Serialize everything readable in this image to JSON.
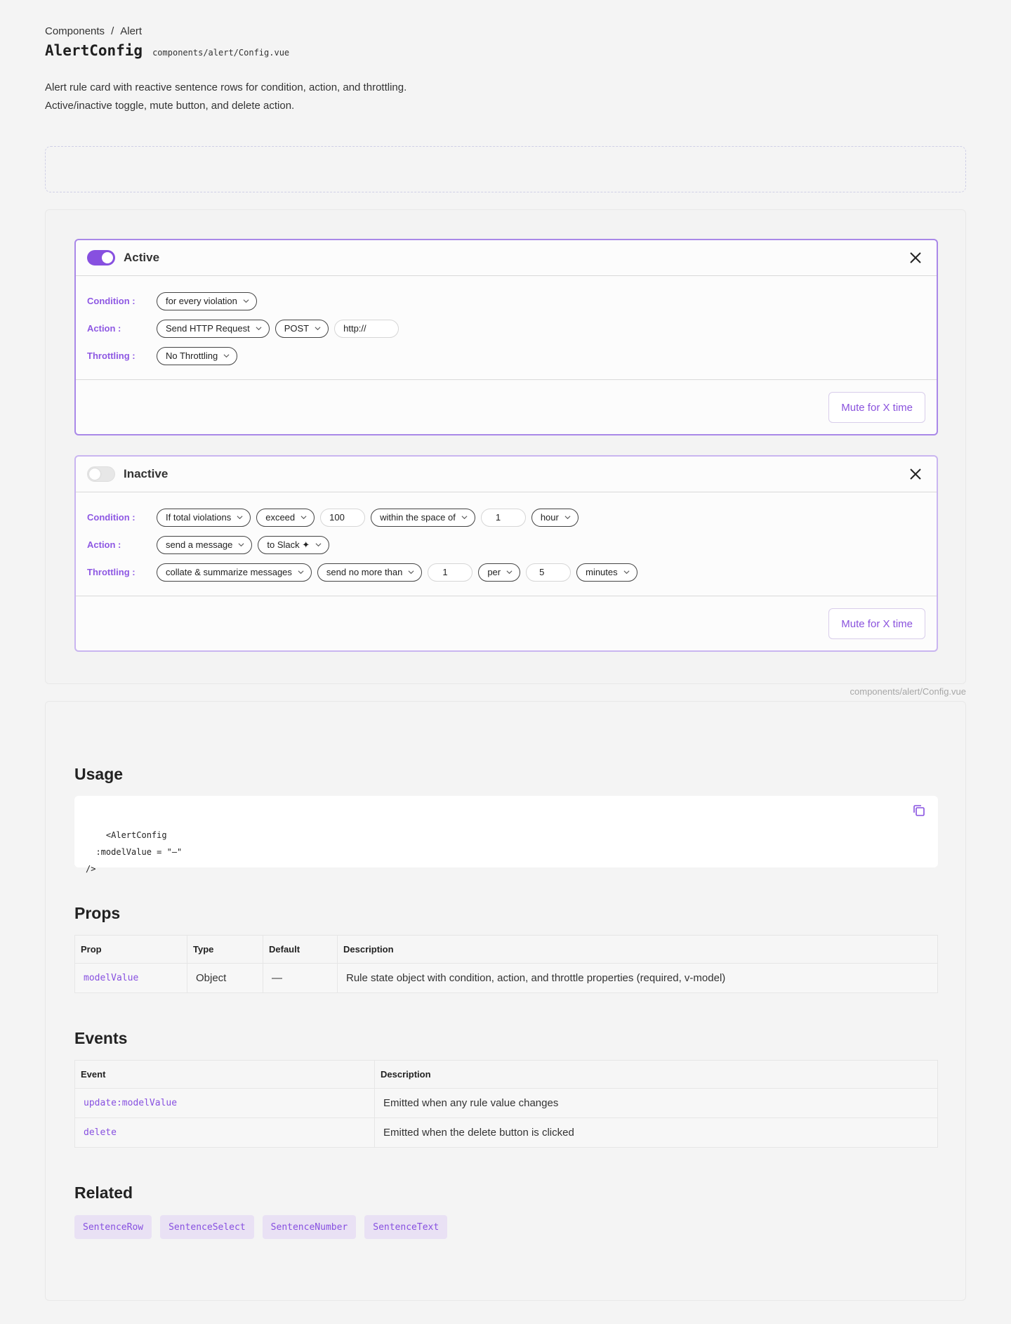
{
  "breadcrumb": {
    "root": "Components",
    "sep": "/",
    "current": "Alert"
  },
  "header": {
    "title": "AlertConfig",
    "path": "components/alert/Config.vue"
  },
  "description": {
    "line1": "Alert rule card with reactive sentence rows for condition, action, and throttling.",
    "line2": "Active/inactive toggle, mute button, and delete action."
  },
  "cards": [
    {
      "state_label": "Active",
      "active": true,
      "condition_label": "Condition :",
      "action_label": "Action :",
      "throttling_label": "Throttling :",
      "condition": [
        "for every violation"
      ],
      "action": {
        "select1": "Send HTTP Request",
        "select2": "POST",
        "text": "http://"
      },
      "throttling": [
        "No Throttling"
      ],
      "mute_label": "Mute for X time"
    },
    {
      "state_label": "Inactive",
      "active": false,
      "condition_label": "Condition :",
      "action_label": "Action :",
      "throttling_label": "Throttling :",
      "condition": {
        "s1": "If total violations",
        "s2": "exceed",
        "n1": "100",
        "s3": "within the space of",
        "n2": "1",
        "s4": "hour"
      },
      "action": {
        "s1": "send a message",
        "s2": "to Slack ✦"
      },
      "throttling": {
        "s1": "collate & summarize messages",
        "s2": "send no more than",
        "n1": "1",
        "s3": "per",
        "n2": "5",
        "s4": "minutes"
      },
      "mute_label": "Mute for X time"
    }
  ],
  "source_path": "components/alert/Config.vue",
  "usage": {
    "heading": "Usage",
    "code": "<AlertConfig\n  :modelValue = \"—\"\n/>"
  },
  "props": {
    "heading": "Props",
    "columns": [
      "Prop",
      "Type",
      "Default",
      "Description"
    ],
    "rows": [
      {
        "prop": "modelValue",
        "type": "Object",
        "default": "—",
        "description": "Rule state object with condition, action, and throttle properties (required, v-model)"
      }
    ]
  },
  "events": {
    "heading": "Events",
    "columns": [
      "Event",
      "Description"
    ],
    "rows": [
      {
        "event": "update:modelValue",
        "description": "Emitted when any rule value changes"
      },
      {
        "event": "delete",
        "description": "Emitted when the delete button is clicked"
      }
    ]
  },
  "related": {
    "heading": "Related",
    "items": [
      "SentenceRow",
      "SentenceSelect",
      "SentenceNumber",
      "SentenceText"
    ]
  },
  "colors": {
    "accent": "#8750e0",
    "accent_border": "#a988e8",
    "chip_bg": "#e9e1f4"
  },
  "icons": {
    "close": "close-icon",
    "chevron": "chevron-down-icon",
    "copy": "copy-icon"
  }
}
